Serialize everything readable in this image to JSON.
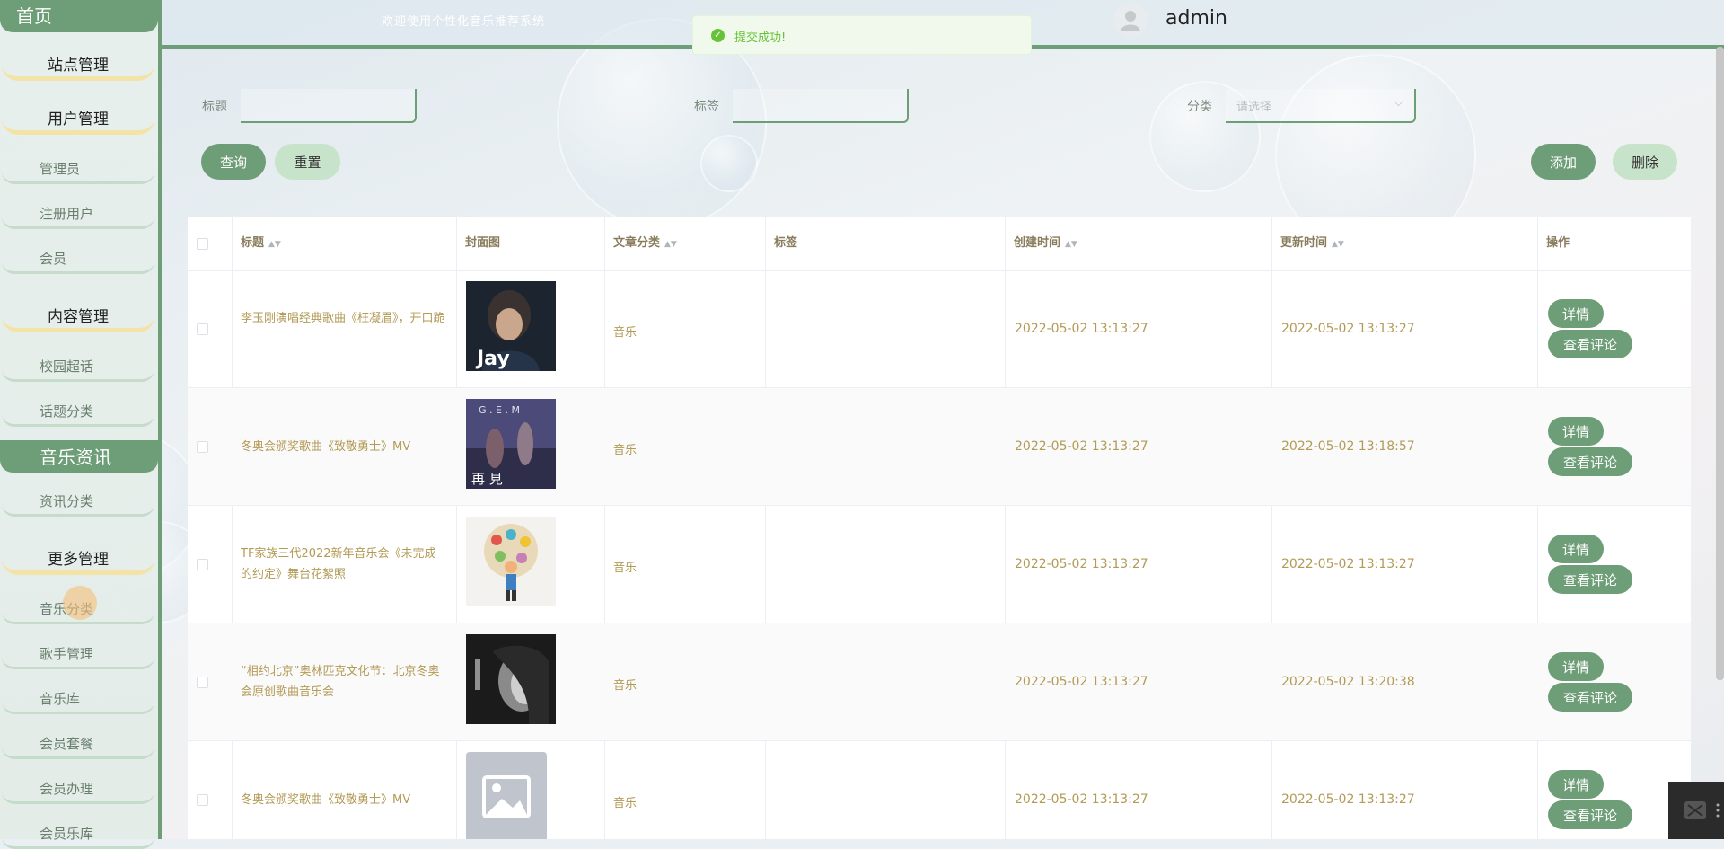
{
  "header": {
    "welcome": "欢迎使用个性化音乐推荐系统",
    "username": "admin"
  },
  "toast": {
    "icon": "success-check-icon",
    "message": "提交成功!"
  },
  "sidebar": {
    "home": "首页",
    "items": [
      {
        "type": "group",
        "label": "站点管理"
      },
      {
        "type": "group",
        "label": "用户管理"
      },
      {
        "type": "item",
        "label": "管理员"
      },
      {
        "type": "item",
        "label": "注册用户"
      },
      {
        "type": "item",
        "label": "会员"
      },
      {
        "type": "group",
        "label": "内容管理"
      },
      {
        "type": "item",
        "label": "校园超话"
      },
      {
        "type": "item",
        "label": "话题分类"
      },
      {
        "type": "active",
        "label": "音乐资讯"
      },
      {
        "type": "item",
        "label": "资讯分类"
      },
      {
        "type": "group",
        "label": "更多管理"
      },
      {
        "type": "item",
        "label": "音乐分类"
      },
      {
        "type": "item",
        "label": "歌手管理"
      },
      {
        "type": "item",
        "label": "音乐库"
      },
      {
        "type": "item",
        "label": "会员套餐"
      },
      {
        "type": "item",
        "label": "会员办理"
      },
      {
        "type": "item",
        "label": "会员乐库"
      }
    ]
  },
  "search": {
    "title_label": "标题",
    "title_value": "",
    "tag_label": "标签",
    "tag_value": "",
    "category_label": "分类",
    "category_placeholder": "请选择",
    "query_button": "查询",
    "reset_button": "重置",
    "add_button": "添加",
    "delete_button": "删除"
  },
  "table": {
    "headers": [
      "标题",
      "封面图",
      "文章分类",
      "标签",
      "创建时间",
      "更新时间",
      "操作"
    ],
    "rows": [
      {
        "title": "李玉刚演唱经典歌曲《枉凝眉》，开口跪",
        "category": "音乐",
        "tag": "",
        "created": "2022-05-02 13:13:27",
        "updated": "2022-05-02 13:13:27",
        "cover": "jay"
      },
      {
        "title": "冬奥会颁奖歌曲《致敬勇士》MV",
        "category": "音乐",
        "tag": "",
        "created": "2022-05-02 13:13:27",
        "updated": "2022-05-02 13:18:57",
        "cover": "gem"
      },
      {
        "title": "TF家族三代2022新年音乐会《未完成的约定》舞台花絮照",
        "category": "音乐",
        "tag": "",
        "created": "2022-05-02 13:13:27",
        "updated": "2022-05-02 13:13:27",
        "cover": "kid"
      },
      {
        "title": "“相约北京”奥林匹克文化节：北京冬奥会原创歌曲音乐会",
        "category": "音乐",
        "tag": "",
        "created": "2022-05-02 13:13:27",
        "updated": "2022-05-02 13:20:38",
        "cover": "bw"
      },
      {
        "title": "冬奥会颁奖歌曲《致敬勇士》MV",
        "category": "音乐",
        "tag": "",
        "created": "2022-05-02 13:13:27",
        "updated": "2022-05-02 13:13:27",
        "cover": "placeholder"
      }
    ],
    "detail_button": "详情",
    "comments_button": "查看评论"
  },
  "cover_texts": {
    "jay": "Jay",
    "gem_top": "G . E . M",
    "gem_bottom": "再 見"
  },
  "colors": {
    "accent": "#6d9e77",
    "light": "#c7e3ca",
    "text": "#b39a55"
  }
}
